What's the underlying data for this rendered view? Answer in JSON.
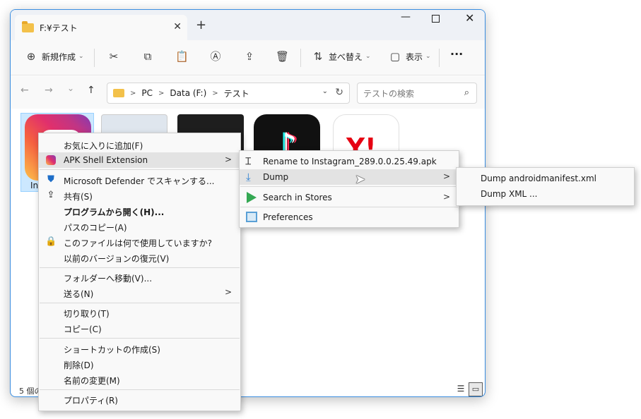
{
  "window": {
    "tab_title": "F:¥テスト",
    "new_tab": "+",
    "minimize": "—",
    "close": "✕"
  },
  "toolbar": {
    "new_label": "新規作成",
    "sort_label": "並べ替え",
    "view_label": "表示",
    "more": "···"
  },
  "nav": {
    "back": "←",
    "forward": "→",
    "recent": "⌄",
    "up": "↑",
    "breadcrumb": [
      "PC",
      "Data (F:)",
      "テスト"
    ],
    "crumb_sep": ">",
    "search_placeholder": "テストの検索"
  },
  "files": {
    "selected_label": "In"
  },
  "statusbar": {
    "count": "5 個の"
  },
  "context_menu": {
    "items": [
      {
        "label": "お気に入りに追加(F)"
      },
      {
        "label": "APK Shell Extension"
      },
      {
        "label": "Microsoft Defender でスキャンする..."
      },
      {
        "label": "共有(S)"
      },
      {
        "label": "プログラムから開く(H)..."
      },
      {
        "label": "パスのコピー(A)"
      },
      {
        "label": "このファイルは何で使用していますか?"
      },
      {
        "label": "以前のバージョンの復元(V)"
      },
      {
        "label": "フォルダーへ移動(V)..."
      },
      {
        "label": "送る(N)"
      },
      {
        "label": "切り取り(T)"
      },
      {
        "label": "コピー(C)"
      },
      {
        "label": "ショートカットの作成(S)"
      },
      {
        "label": "削除(D)"
      },
      {
        "label": "名前の変更(M)"
      },
      {
        "label": "プロパティ(R)"
      }
    ]
  },
  "apk_menu": {
    "items": [
      {
        "label": "Rename to Instagram_289.0.0.25.49.apk"
      },
      {
        "label": "Dump"
      },
      {
        "label": "Search in Stores"
      },
      {
        "label": "Preferences"
      }
    ]
  },
  "dump_menu": {
    "items": [
      {
        "label": "Dump androidmanifest.xml"
      },
      {
        "label": "Dump XML ..."
      }
    ]
  },
  "submenu_arrow": ">"
}
